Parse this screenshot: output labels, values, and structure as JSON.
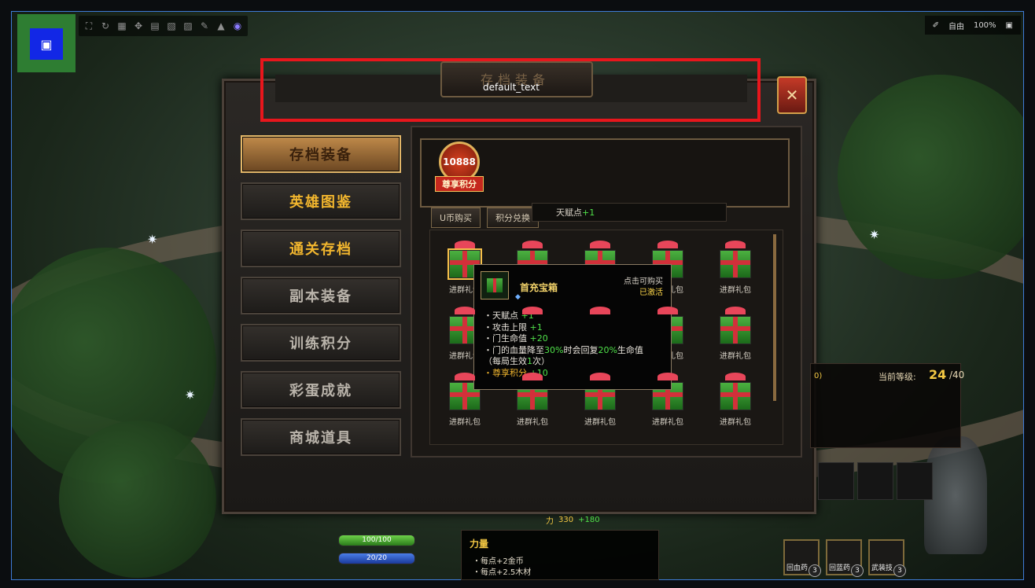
{
  "header": {
    "placeholder_text": "default_text",
    "panel_title": "存档装备"
  },
  "menu": [
    {
      "label": "存档装备",
      "style": "active"
    },
    {
      "label": "英雄图鉴",
      "style": "gold"
    },
    {
      "label": "通关存档",
      "style": "gold"
    },
    {
      "label": "副本装备",
      "style": "normal"
    },
    {
      "label": "训练积分",
      "style": "normal"
    },
    {
      "label": "彩蛋成就",
      "style": "normal"
    },
    {
      "label": "商城道具",
      "style": "normal"
    }
  ],
  "banner": {
    "points": "10888",
    "points_label": "尊享积分"
  },
  "tabs": {
    "ubuy": "U币购买",
    "exchange": "积分兑换"
  },
  "talent_strip": {
    "text": "天赋点",
    "plus": "+1"
  },
  "gift_label": "进群礼包",
  "tooltip": {
    "name": "首充宝箱",
    "buy": "点击可购买",
    "activated": "已激活",
    "lines": [
      {
        "pre": "・天赋点 ",
        "val": "+1",
        "post": ""
      },
      {
        "pre": "・攻击上限 ",
        "val": "+1",
        "post": ""
      },
      {
        "pre": "・门生命值 ",
        "val": "+20",
        "post": ""
      },
      {
        "pre": "・门的血量降至",
        "val": "30%",
        "post": "时会回复"
      },
      {
        "pre": "（每局生效",
        "val": "1",
        "post": "次）"
      }
    ],
    "line4_extra_val": "20%",
    "line4_extra_post": "生命值",
    "points_line_label": "・尊享积分",
    "points_line_val": " +10"
  },
  "level": {
    "label": "当前等级:",
    "value": "24",
    "max": "/40",
    "fragment": "0)"
  },
  "hud": {
    "hp": "100/100",
    "mp": "20/20"
  },
  "stat": {
    "value": "330",
    "plus": "+180"
  },
  "strength": {
    "title": "力量",
    "line1": "・每点+2金币",
    "line2": "・每点+2.5木材"
  },
  "items": [
    {
      "name": "回血药",
      "count": "3"
    },
    {
      "name": "回蓝药",
      "count": "3"
    },
    {
      "name": "武装技",
      "count": "3"
    }
  ],
  "topbar_right": {
    "mode": "自由",
    "zoom": "100%"
  }
}
